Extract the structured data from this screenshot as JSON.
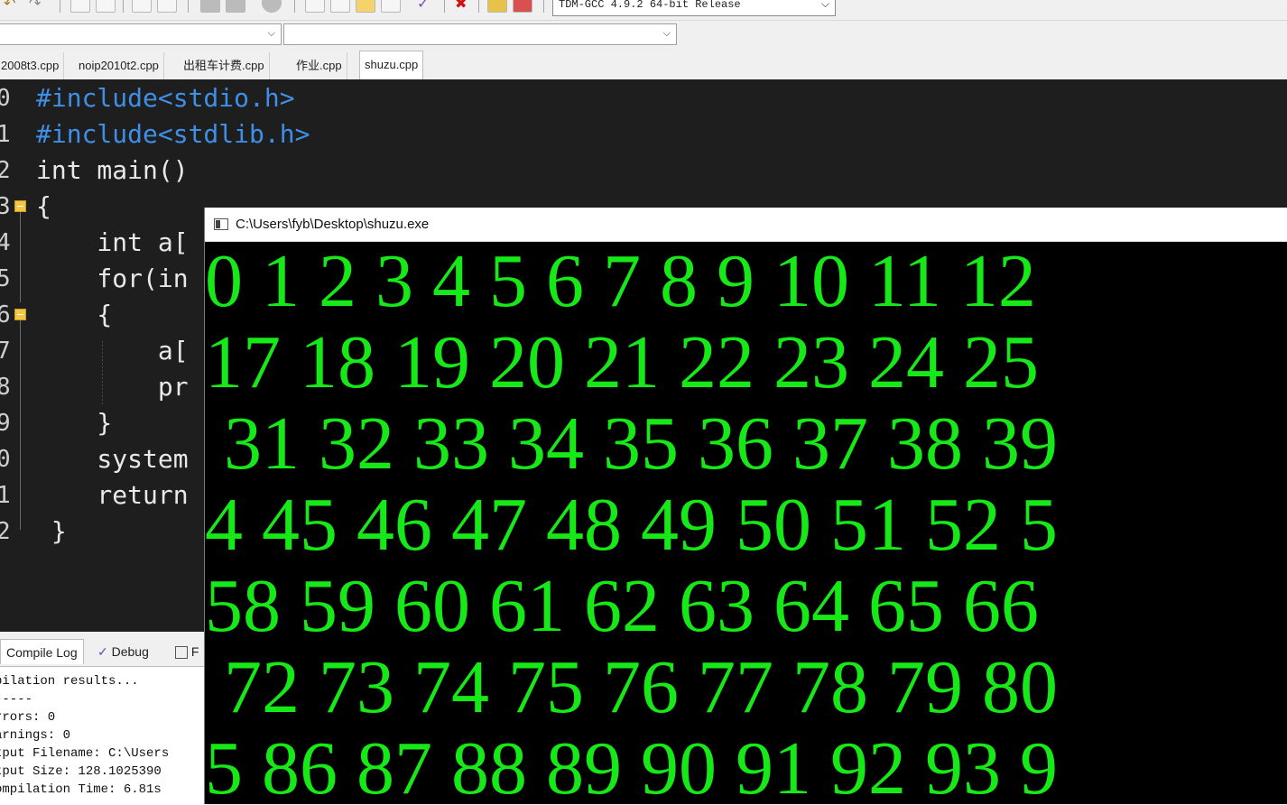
{
  "toolbar": {
    "compiler": "TDM-GCC 4.9.2 64-bit Release",
    "icons": [
      "undo-icon",
      "redo-icon",
      "search-icon",
      "find-in-files-icon",
      "indent-icon",
      "unindent-icon",
      "bookmark-icon",
      "bookmark-next-icon",
      "stop-icon",
      "grid-icon",
      "window-icon",
      "chart-icon",
      "layout-icon",
      "check-icon",
      "close-icon",
      "bar-chart-icon",
      "delete-chart-icon"
    ]
  },
  "tabs": [
    {
      "label": "2008t3.cpp",
      "active": false
    },
    {
      "label": "noip2010t2.cpp",
      "active": false
    },
    {
      "label": "出租车计费.cpp",
      "active": false
    },
    {
      "label": "作业.cpp",
      "active": false
    },
    {
      "label": "shuzu.cpp",
      "active": true
    }
  ],
  "editor": {
    "line_numbers": [
      "0",
      "1",
      "2",
      "3",
      "4",
      "5",
      "6",
      "7",
      "8",
      "9",
      "0",
      "1",
      "2"
    ],
    "lines": [
      "#include<stdio.h>",
      "#include<stdlib.h>",
      "int main()",
      "{",
      "    int a[",
      "    for(in",
      "    {",
      "        a[",
      "        pr",
      "    }",
      "    system",
      "    return",
      " }"
    ]
  },
  "bottom_tabs": {
    "compile_log": "Compile Log",
    "debug": "Debug",
    "find": "F"
  },
  "compile_log": [
    "pilation results...",
    "-----",
    "rrors: 0",
    "arnings: 0",
    "tput Filename: C:\\Users",
    "tput Size: 128.1025390",
    "ompilation Time: 6.81s"
  ],
  "console": {
    "title": "C:\\Users\\fyb\\Desktop\\shuzu.exe",
    "lines": [
      "0 1 2 3 4 5 6 7 8 9 10 11 12",
      "17 18 19 20 21 22 23 24 25",
      " 31 32 33 34 35 36 37 38 39",
      "4 45 46 47 48 49 50 51 52 5",
      "58 59 60 61 62 63 64 65 66",
      " 72 73 74 75 76 77 78 79 80",
      "5 86 87 88 89 90 91 92 93 9"
    ],
    "text_color": "#17e817"
  }
}
